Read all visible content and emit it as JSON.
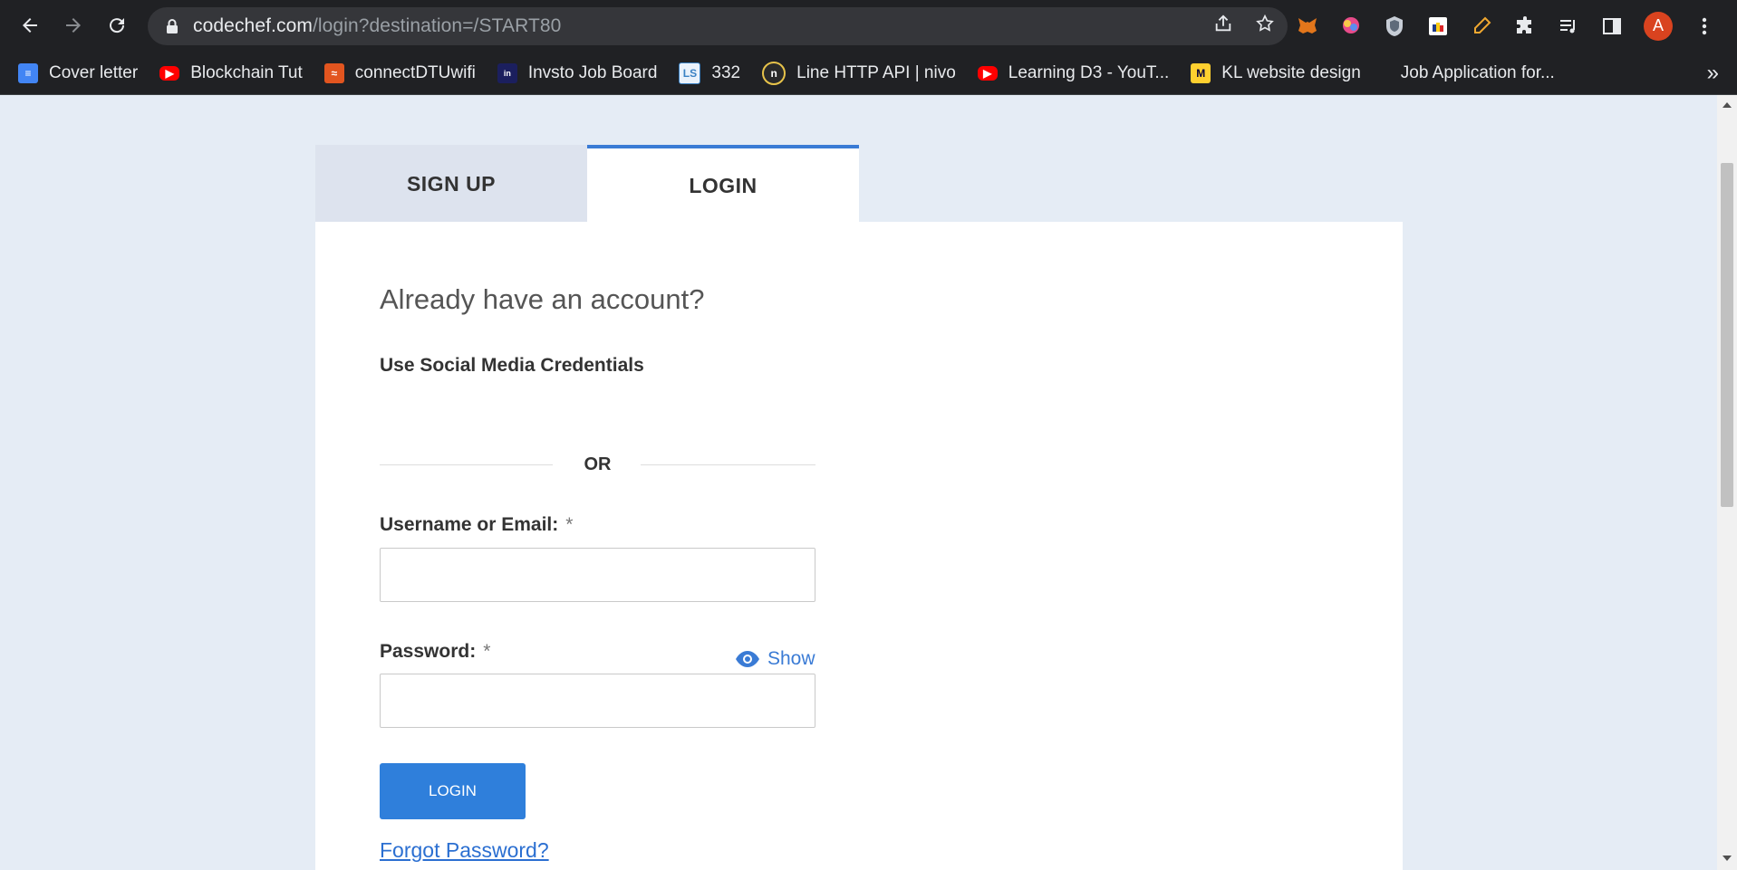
{
  "browser": {
    "url_host": "codechef.com",
    "url_path": "/login?destination=/START80",
    "profile_initial": "A",
    "bookmarks": [
      {
        "label": "Cover letter",
        "icon": "docs-icon",
        "color": "#4285f4"
      },
      {
        "label": "Blockchain Tut",
        "icon": "youtube-icon",
        "color": "#ff0000"
      },
      {
        "label": "connectDTUwifi",
        "icon": "wifi-logo-icon",
        "color": "#e2551f"
      },
      {
        "label": "Invsto Job Board",
        "icon": "invsto-icon",
        "color": "#1b1f5e"
      },
      {
        "label": "332",
        "icon": "ls-icon",
        "color": "#3b82c4"
      },
      {
        "label": "Line HTTP API | nivo",
        "icon": "nivo-icon",
        "color": "#2a2a2a"
      },
      {
        "label": "Learning D3 - YouT...",
        "icon": "youtube-icon",
        "color": "#ff0000"
      },
      {
        "label": "KL website design",
        "icon": "miro-icon",
        "color": "#ffd02f"
      },
      {
        "label": "Job Application for...",
        "icon": "",
        "color": ""
      }
    ]
  },
  "page": {
    "tabs": {
      "signup": "SIGN UP",
      "login": "LOGIN"
    },
    "headline": "Already have an account?",
    "social": "Use Social Media Credentials",
    "or": "OR",
    "username_label": "Username or Email:",
    "password_label": "Password:",
    "required_mark": "*",
    "show": "Show",
    "login_button": "LOGIN",
    "forgot": "Forgot Password?"
  },
  "colors": {
    "accent": "#3a7bd5",
    "button": "#2f7fdb",
    "page_bg": "#e5ecf5"
  }
}
